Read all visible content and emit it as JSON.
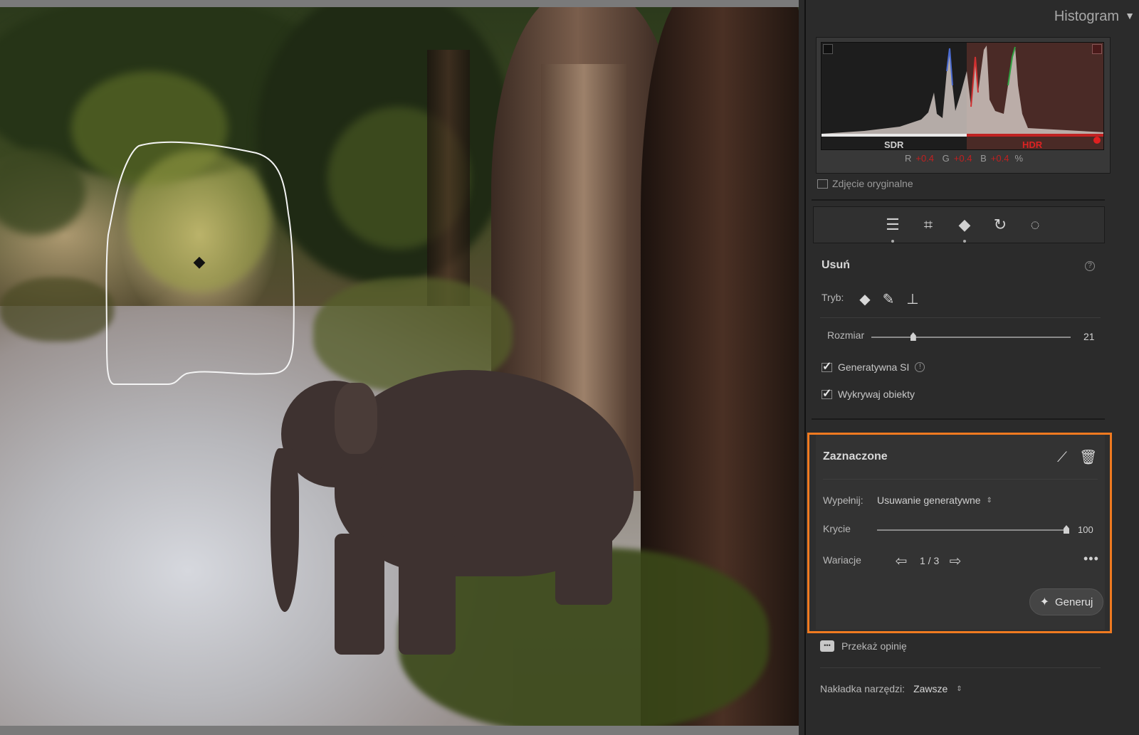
{
  "histogram": {
    "title": "Histogram",
    "sdr_label": "SDR",
    "hdr_label": "HDR",
    "r_label": "R",
    "r_value": "+0.4",
    "g_label": "G",
    "g_value": "+0.4",
    "b_label": "B",
    "b_value": "+0.4",
    "percent": "%",
    "original_photo_label": "Zdjęcie oryginalne"
  },
  "tools": [
    "sliders-icon",
    "crop-icon",
    "eraser-icon",
    "healing-rotate-icon",
    "masking-icon"
  ],
  "remove": {
    "title": "Usuń",
    "mode_label": "Tryb:",
    "size_label": "Rozmiar",
    "size_value": "21",
    "size_fraction": 0.21,
    "generative_ai_label": "Generatywna SI",
    "detect_objects_label": "Wykrywaj obiekty"
  },
  "selected": {
    "title": "Zaznaczone",
    "fill_label": "Wypełnij:",
    "fill_value": "Usuwanie generatywne",
    "opacity_label": "Krycie",
    "opacity_value": "100",
    "opacity_fraction": 1.0,
    "variations_label": "Wariacje",
    "variations_value": "1 / 3",
    "more_label": "•••",
    "generate_label": "Generuj"
  },
  "footer": {
    "feedback_label": "Przekaż opinię",
    "overlay_label": "Nakładka narzędzi:",
    "overlay_value": "Zawsze"
  },
  "colors": {
    "accent_highlight": "#f07a20",
    "hdr_red": "#c02020"
  }
}
